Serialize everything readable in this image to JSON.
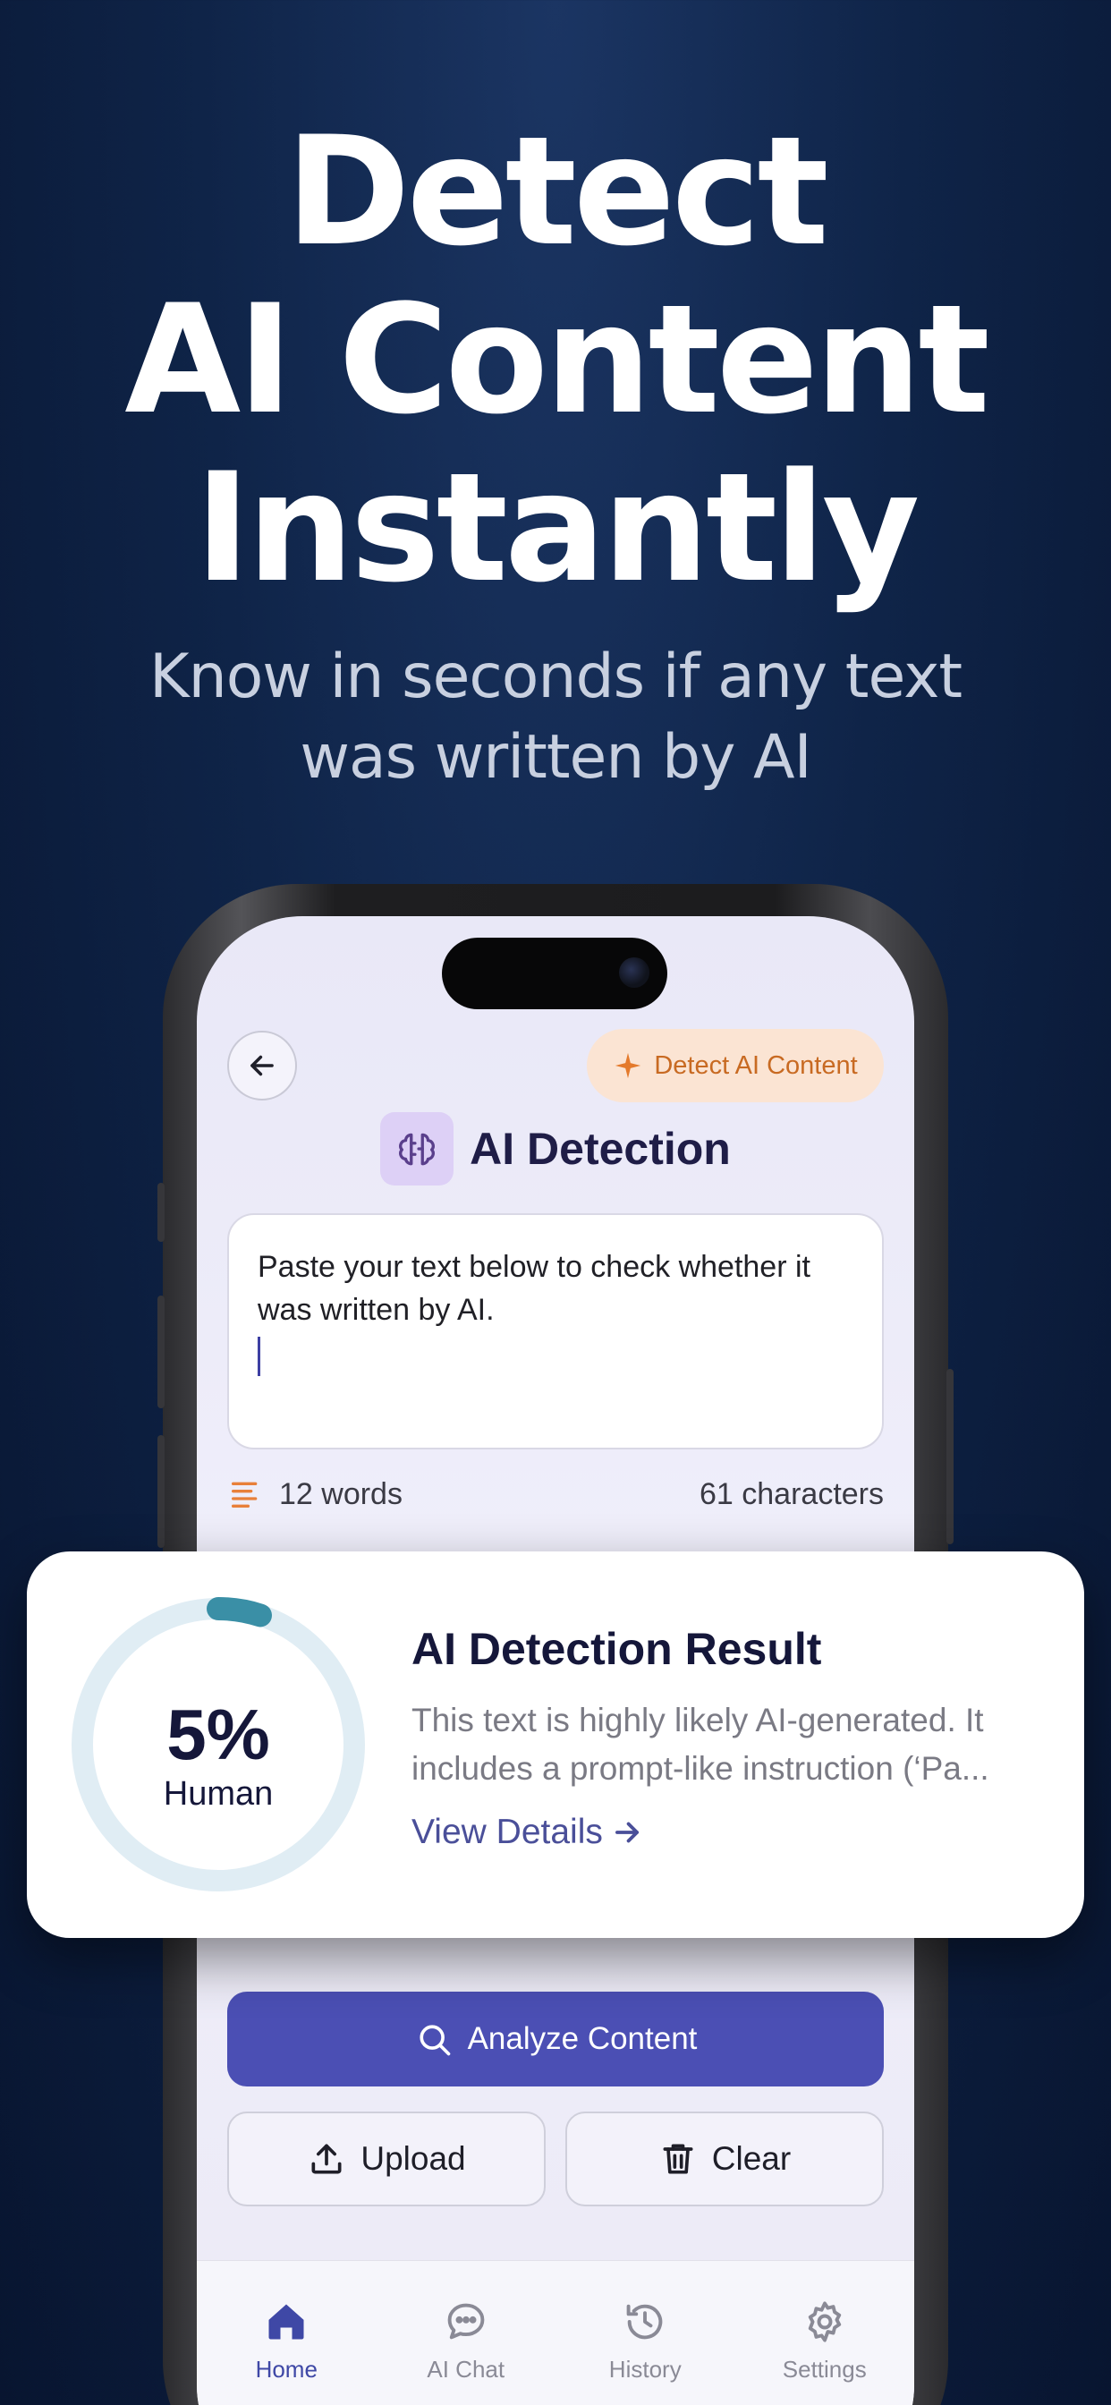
{
  "hero": {
    "title_lines": [
      "Detect",
      "AI Content",
      "Instantly"
    ],
    "subtitle_lines": [
      "Know in seconds if any text",
      "was written by AI"
    ]
  },
  "app": {
    "header": {
      "badge_label": "Detect AI Content",
      "title": "AI Detection"
    },
    "input": {
      "text": "Paste your text below to check whether it was written by AI."
    },
    "stats": {
      "words": "12 words",
      "characters": "61 characters"
    },
    "actions": {
      "analyze_label": "Analyze Content",
      "upload_label": "Upload",
      "clear_label": "Clear"
    },
    "tabs": [
      {
        "label": "Home",
        "icon": "home-icon",
        "active": true
      },
      {
        "label": "AI Chat",
        "icon": "chat-icon",
        "active": false
      },
      {
        "label": "History",
        "icon": "history-icon",
        "active": false
      },
      {
        "label": "Settings",
        "icon": "gear-icon",
        "active": false
      }
    ]
  },
  "result": {
    "percent_label": "5%",
    "percent_value": 5,
    "gauge_caption": "Human",
    "title": "AI Detection Result",
    "description_lines": [
      "This text is highly likely AI-generated. It",
      "includes a prompt-like instruction (‘Pa..."
    ],
    "link_label": "View Details"
  },
  "colors": {
    "background": "#0f2448",
    "accent": "#4b4fb4",
    "badge_text": "#c86a22",
    "gauge_track": "#e0edf4",
    "gauge_fill": "#3a8fa6"
  }
}
